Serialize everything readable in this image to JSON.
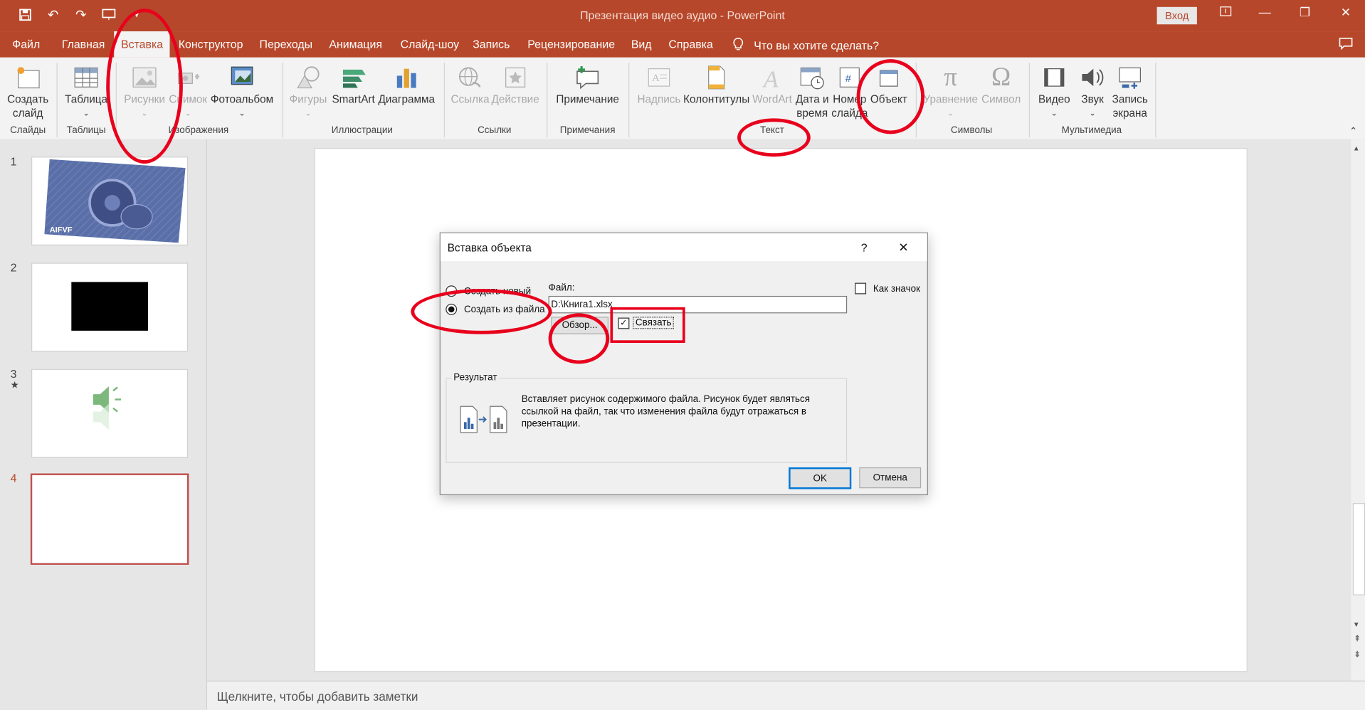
{
  "app": {
    "window_title": "Презентация видео аудио  -  PowerPoint",
    "sign_in": "Вход"
  },
  "menu": [
    "Файл",
    "Главная",
    "Вставка",
    "Конструктор",
    "Переходы",
    "Анимация",
    "Слайд-шоу",
    "Запись",
    "Рецензирование",
    "Вид",
    "Справка"
  ],
  "tell_me": "Что вы хотите сделать?",
  "ribbon": {
    "buttons": {
      "new_slide": "Создать\nслайд",
      "table": "Таблица",
      "pictures": "Рисунки",
      "screenshot": "Снимок",
      "album": "Фотоальбом",
      "shapes": "Фигуры",
      "smartart": "SmartArt",
      "chart": "Диаграмма",
      "link": "Ссылка",
      "action": "Действие",
      "comment": "Примечание",
      "textbox": "Надпись",
      "header": "Колонтитулы",
      "wordart": "WordArt",
      "datetime": "Дата и\nвремя",
      "slidenum": "Номер\nслайда",
      "object": "Объект",
      "equation": "Уравнение",
      "symbol": "Символ",
      "video": "Видео",
      "audio": "Звук",
      "screenrec": "Запись\nэкрана"
    },
    "groups": {
      "slides": "Слайды",
      "tables": "Таблицы",
      "images": "Изображения",
      "illustrations": "Иллюстрации",
      "links": "Ссылки",
      "comments": "Примечания",
      "text": "Текст",
      "symbols": "Символы",
      "media": "Мультимедиа"
    }
  },
  "slides": [
    {
      "num": "1",
      "thumb_text": "AIFVF"
    },
    {
      "num": "2"
    },
    {
      "num": "3",
      "star": "★"
    },
    {
      "num": "4"
    }
  ],
  "notes_placeholder": "Щелкните, чтобы добавить заметки",
  "dialog": {
    "title": "Вставка объекта",
    "help": "?",
    "close": "✕",
    "opt_new": "Создать новый",
    "opt_file": "Создать из файла",
    "file_label": "Файл:",
    "file_value": "D:\\Книга1.xlsx",
    "browse": "Обзор...",
    "link": "Связать",
    "as_icon": "Как значок",
    "result_label": "Результат",
    "result_text": "Вставляет рисунок содержимого файла. Рисунок будет являться ссылкой на файл, так что изменения файла будут отражаться в презентации.",
    "ok": "OK",
    "cancel": "Отмена"
  }
}
